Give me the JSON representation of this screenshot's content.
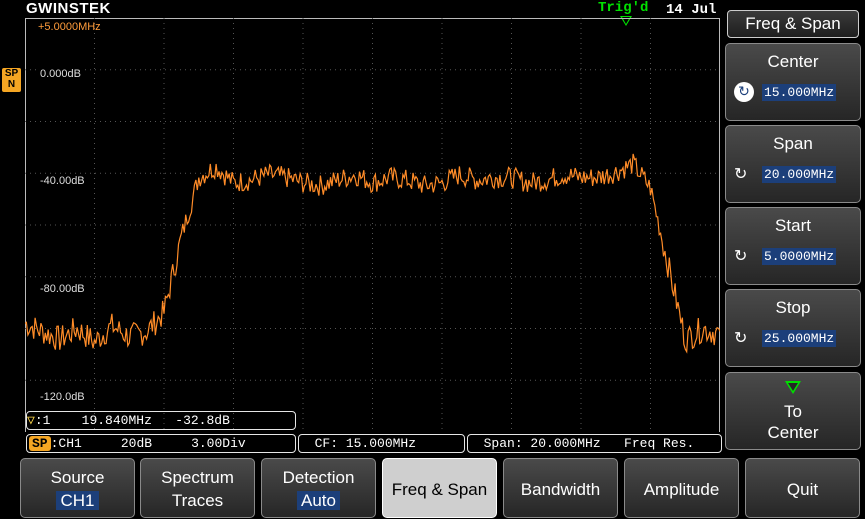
{
  "header": {
    "brand": "GWINSTEK",
    "trig_status": "Trig'd",
    "date": "14 Jul"
  },
  "display": {
    "top_freq": "+5.0000MHz",
    "sp_badge": "SP N",
    "y_labels": [
      "0.000dB",
      "-40.00dB",
      "-80.00dB",
      "-120.0dB"
    ]
  },
  "chart_data": {
    "type": "line",
    "xlabel": "",
    "ylabel": "",
    "x_unit": "MHz",
    "y_unit": "dB",
    "xlim": [
      5.0,
      25.0
    ],
    "ylim": [
      -120,
      0
    ],
    "grid": true,
    "series": [
      {
        "color": "#ff8c28",
        "x": [
          5.0,
          5.5,
          6.0,
          6.5,
          7.0,
          7.5,
          8.0,
          8.5,
          9.0,
          9.5,
          10.0,
          10.5,
          11.0,
          11.5,
          12.0,
          12.5,
          13.0,
          13.5,
          14.0,
          14.5,
          15.0,
          15.5,
          16.0,
          16.5,
          17.0,
          17.5,
          18.0,
          18.5,
          19.0,
          19.5,
          20.0,
          20.5,
          21.0,
          21.5,
          22.0,
          22.5,
          23.0,
          23.5,
          24.0,
          24.5,
          25.0
        ],
        "y": [
          -92,
          -95,
          -98,
          -94,
          -99,
          -93,
          -97,
          -95,
          -88,
          -60,
          -38,
          -34,
          -40,
          -39,
          -37,
          -38,
          -40,
          -41,
          -39,
          -37,
          -40,
          -38,
          -39,
          -41,
          -40,
          -37,
          -39,
          -38,
          -38,
          -40,
          -39,
          -37,
          -38,
          -38,
          -36,
          -33,
          -42,
          -70,
          -98,
          -94,
          -96
        ]
      }
    ]
  },
  "status": {
    "marker_symbol": "▽",
    "marker_index": ":1",
    "marker_freq": "19.840MHz",
    "marker_level": "-32.8dB",
    "sp_tag": "SP",
    "source": ":CH1",
    "ref_level": "20dB",
    "scale": "3.00Div",
    "cf": "CF: 15.000MHz",
    "span": "Span: 20.000MHz",
    "freq_res": "Freq Res."
  },
  "menu": {
    "title": "Freq & Span",
    "center_label": "Center",
    "center_value": "15.000MHz",
    "span_label": "Span",
    "span_value": "20.000MHz",
    "start_label": "Start",
    "start_value": "5.0000MHz",
    "stop_label": "Stop",
    "stop_value": "25.000MHz",
    "to_center_l1": "To",
    "to_center_l2": "Center",
    "knob_icon": "↻"
  },
  "softkeys": {
    "source_label": "Source",
    "source_value": "CH1",
    "traces_l1": "Spectrum",
    "traces_l2": "Traces",
    "detection_label": "Detection",
    "detection_value": "Auto",
    "freq_span": "Freq & Span",
    "bandwidth": "Bandwidth",
    "amplitude": "Amplitude",
    "quit": "Quit"
  }
}
